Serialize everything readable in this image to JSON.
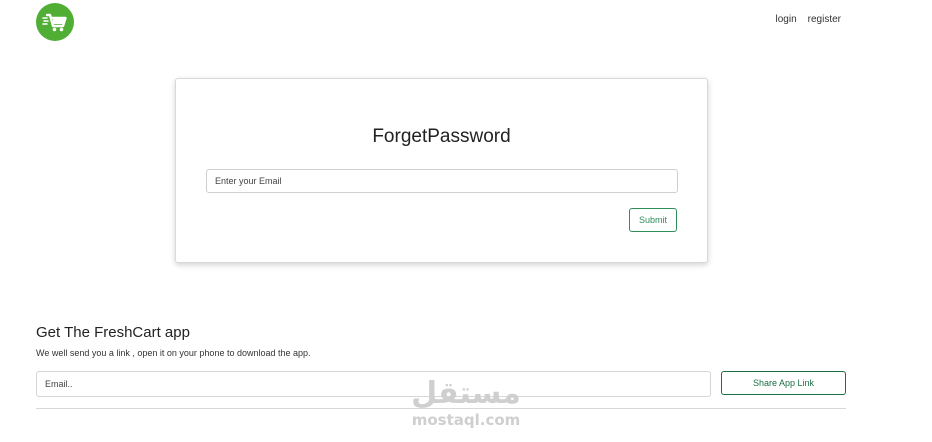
{
  "colors": {
    "brand_green": "#4fae33",
    "button_green": "#2f8f5b",
    "share_green": "#1c6e45"
  },
  "navbar": {
    "logo_icon": "shopping-cart-icon",
    "login_label": "login",
    "register_label": "register"
  },
  "forget_card": {
    "title": "ForgetPassword",
    "email_placeholder": "Enter your Email",
    "email_value": "",
    "submit_label": "Submit"
  },
  "app_section": {
    "title": "Get The FreshCart app",
    "description": "We well send you a link , open it on your phone to download the app.",
    "email_placeholder": "Email..",
    "email_value": "",
    "share_label": "Share App Link"
  },
  "watermark": {
    "arabic": "مستقل",
    "latin": "mostaql.com"
  }
}
